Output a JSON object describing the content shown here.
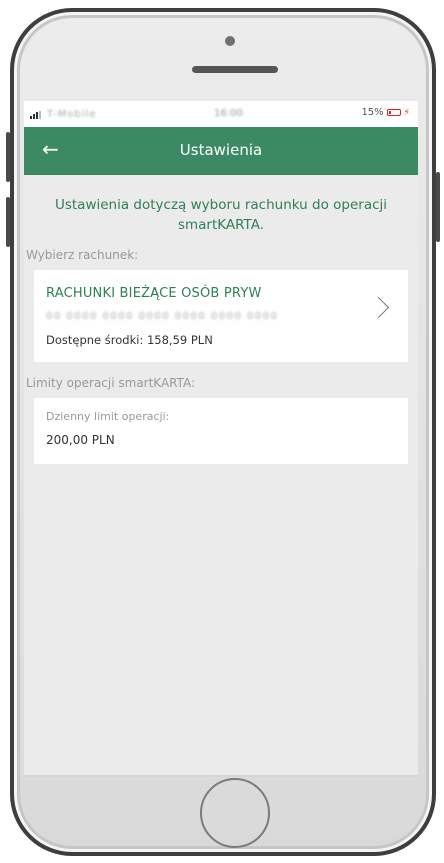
{
  "status_bar": {
    "carrier": "T-Mobile",
    "time": "16:00",
    "battery": "15%"
  },
  "header": {
    "back_icon": "arrow-left-icon",
    "title": "Ustawienia"
  },
  "intro_text": "Ustawienia dotyczą wyboru rachunku do operacji smartKARTA.",
  "account_section": {
    "label": "Wybierz rachunek:",
    "account_name": "RACHUNKI BIEŻĄCE OSÓB PRYW",
    "account_number": "00 0000 0000 0000 0000 0000 0000",
    "available_funds": "Dostępne środki: 158,59 PLN",
    "chevron_icon": "chevron-right-icon"
  },
  "limits_section": {
    "label": "Limity operacji smartKARTA:",
    "daily_limit_label": "Dzienny limit operacji:",
    "daily_limit_value": "200,00 PLN"
  },
  "colors": {
    "accent": "#3b8a63",
    "accent_text": "#2f7f57",
    "battery_low": "#e02020"
  }
}
